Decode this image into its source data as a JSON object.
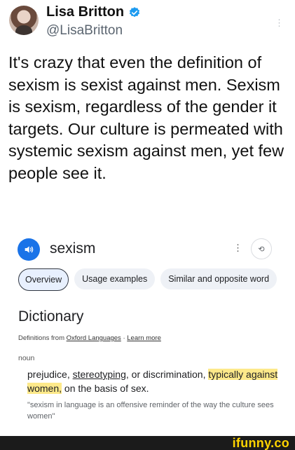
{
  "tweet": {
    "display_name": "Lisa Britton",
    "handle": "@LisaBritton",
    "text": "It's crazy that even the definition of sexism is sexist against men. Sexism is sexism, regardless of the gender it targets. Our culture is permeated with systemic sexism against men, yet few people see it.",
    "verified_icon": "verified-badge-icon",
    "colors": {
      "verified": "#1d9bf0"
    }
  },
  "dictionary_card": {
    "word": "sexism",
    "speaker_icon": "speaker-icon",
    "tabs": [
      "Overview",
      "Usage examples",
      "Similar and opposite word"
    ],
    "heading": "Dictionary",
    "source_prefix": "Definitions from",
    "source_link": "Oxford Languages",
    "source_separator": "·",
    "learn_more": "Learn more",
    "part_of_speech": "noun",
    "definition": {
      "part1": "prejudice, ",
      "link": "stereotyping",
      "part2": ", or discrimination, ",
      "highlighted": "typically against women,",
      "part3": " on the basis of sex."
    },
    "example": "\"sexism in language is an offensive reminder of the way the culture sees women\"",
    "colors": {
      "accent": "#1a73e8",
      "highlight": "#fde98a"
    }
  },
  "watermark": "ifunny.co"
}
